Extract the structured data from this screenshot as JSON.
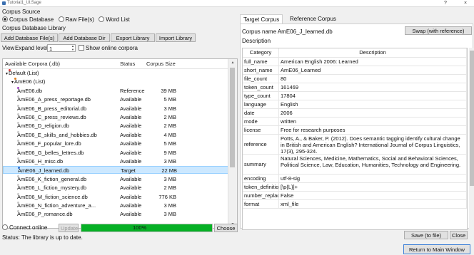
{
  "window": {
    "title": "Tutorial1_Ul.Sage"
  },
  "left": {
    "corpus_source_label": "Corpus Source",
    "source_options": [
      "Corpus Database",
      "Raw File(s)",
      "Word List"
    ],
    "library_label": "Corpus Database Library",
    "buttons": {
      "add_files": "Add Database File(s)",
      "add_dir": "Add Database Dir",
      "export": "Export Library",
      "import": "Import Library"
    },
    "view_label": "View",
    "expand_label": "Expand level",
    "expand_value": "1",
    "show_online": "Show online corpora",
    "tree": {
      "columns": [
        "Available Corpora (.db)",
        "Status",
        "Corpus Size"
      ],
      "rows": [
        {
          "name": "Default (List)",
          "status": "",
          "size": "",
          "level": 0,
          "color": "#e03030"
        },
        {
          "name": "AmE06 (List)",
          "status": "",
          "size": "",
          "level": 1,
          "color": "#e08020"
        },
        {
          "name": "AmE06.db",
          "status": "Reference",
          "size": "39 MB",
          "level": 2,
          "color": "#a040c0"
        },
        {
          "name": "AmE06_A_press_reportage.db",
          "status": "Available",
          "size": "5 MB",
          "level": 2,
          "color": "#c8c8c8"
        },
        {
          "name": "AmE06_B_press_editorial.db",
          "status": "Available",
          "size": "3 MB",
          "level": 2,
          "color": "#c8c8c8"
        },
        {
          "name": "AmE06_C_press_reviews.db",
          "status": "Available",
          "size": "2 MB",
          "level": 2,
          "color": "#c8c8c8"
        },
        {
          "name": "AmE06_D_religion.db",
          "status": "Available",
          "size": "2 MB",
          "level": 2,
          "color": "#c8c8c8"
        },
        {
          "name": "AmE06_E_skills_and_hobbies.db",
          "status": "Available",
          "size": "4 MB",
          "level": 2,
          "color": "#c8c8c8"
        },
        {
          "name": "AmE06_F_popular_lore.db",
          "status": "Available",
          "size": "5 MB",
          "level": 2,
          "color": "#c8c8c8"
        },
        {
          "name": "AmE06_G_belles_lettres.db",
          "status": "Available",
          "size": "9 MB",
          "level": 2,
          "color": "#c8c8c8"
        },
        {
          "name": "AmE06_H_misc.db",
          "status": "Available",
          "size": "3 MB",
          "level": 2,
          "color": "#c8c8c8"
        },
        {
          "name": "AmE06_J_learned.db",
          "status": "Target",
          "size": "22 MB",
          "level": 2,
          "color": "#3070d0",
          "selected": true
        },
        {
          "name": "AmE06_K_fiction_general.db",
          "status": "Available",
          "size": "3 MB",
          "level": 2,
          "color": "#c8c8c8"
        },
        {
          "name": "AmE06_L_fiction_mystery.db",
          "status": "Available",
          "size": "2 MB",
          "level": 2,
          "color": "#c8c8c8"
        },
        {
          "name": "AmE06_M_fiction_science.db",
          "status": "Available",
          "size": "776 KB",
          "level": 2,
          "color": "#c8c8c8"
        },
        {
          "name": "AmE06_N_fiction_adventure_a...",
          "status": "Available",
          "size": "3 MB",
          "level": 2,
          "color": "#c8c8c8"
        },
        {
          "name": "AmE06_P_romance.db",
          "status": "Available",
          "size": "3 MB",
          "level": 2,
          "color": "#c8c8c8"
        }
      ]
    },
    "connect_online": "Connect online",
    "update_label": "Update",
    "progress": {
      "value": 1.0,
      "label": "100%"
    },
    "choose_label": "Choose",
    "status_text": "Status: The library is up to date."
  },
  "right": {
    "tabs": [
      "Target Corpus",
      "Reference Corpus"
    ],
    "corpus_name_label": "Corpus name",
    "corpus_name_value": "AmE06_J_learned.db",
    "swap_label": "Swap (with reference)",
    "description_label": "Description",
    "table": {
      "headers": [
        "Category",
        "Description"
      ],
      "rows": [
        {
          "cat": "full_name",
          "desc": "American English 2006: Learned"
        },
        {
          "cat": "short_name",
          "desc": "AmE06_Learned"
        },
        {
          "cat": "file_count",
          "desc": "80"
        },
        {
          "cat": "token_count",
          "desc": "161469"
        },
        {
          "cat": "type_count",
          "desc": "17804"
        },
        {
          "cat": "language",
          "desc": "English"
        },
        {
          "cat": "date",
          "desc": "2006"
        },
        {
          "cat": "mode",
          "desc": "written"
        },
        {
          "cat": "license",
          "desc": "Free for research purposes"
        },
        {
          "cat": "reference",
          "desc": "Potts, A., & Baker, P. (2012). Does semantic tagging identify cultural change in British and American English? International Journal of Corpus Linguistics, 17(3), 295-324."
        },
        {
          "cat": "summary",
          "desc": "Natural Sciences, Medicine, Mathematics, Social and Behavioral Sciences, Political Science, Law, Education, Humanities, Technology and Engineering."
        },
        {
          "cat": "encoding",
          "desc": "utf-8-sig"
        },
        {
          "cat": "token_definition",
          "desc": "[\\p{L}]+"
        },
        {
          "cat": "number_replace",
          "desc": "False"
        },
        {
          "cat": "format",
          "desc": "xml_file"
        }
      ]
    },
    "save_label": "Save (to file)",
    "close_label": "Close",
    "return_label": "Return to Main Window"
  }
}
